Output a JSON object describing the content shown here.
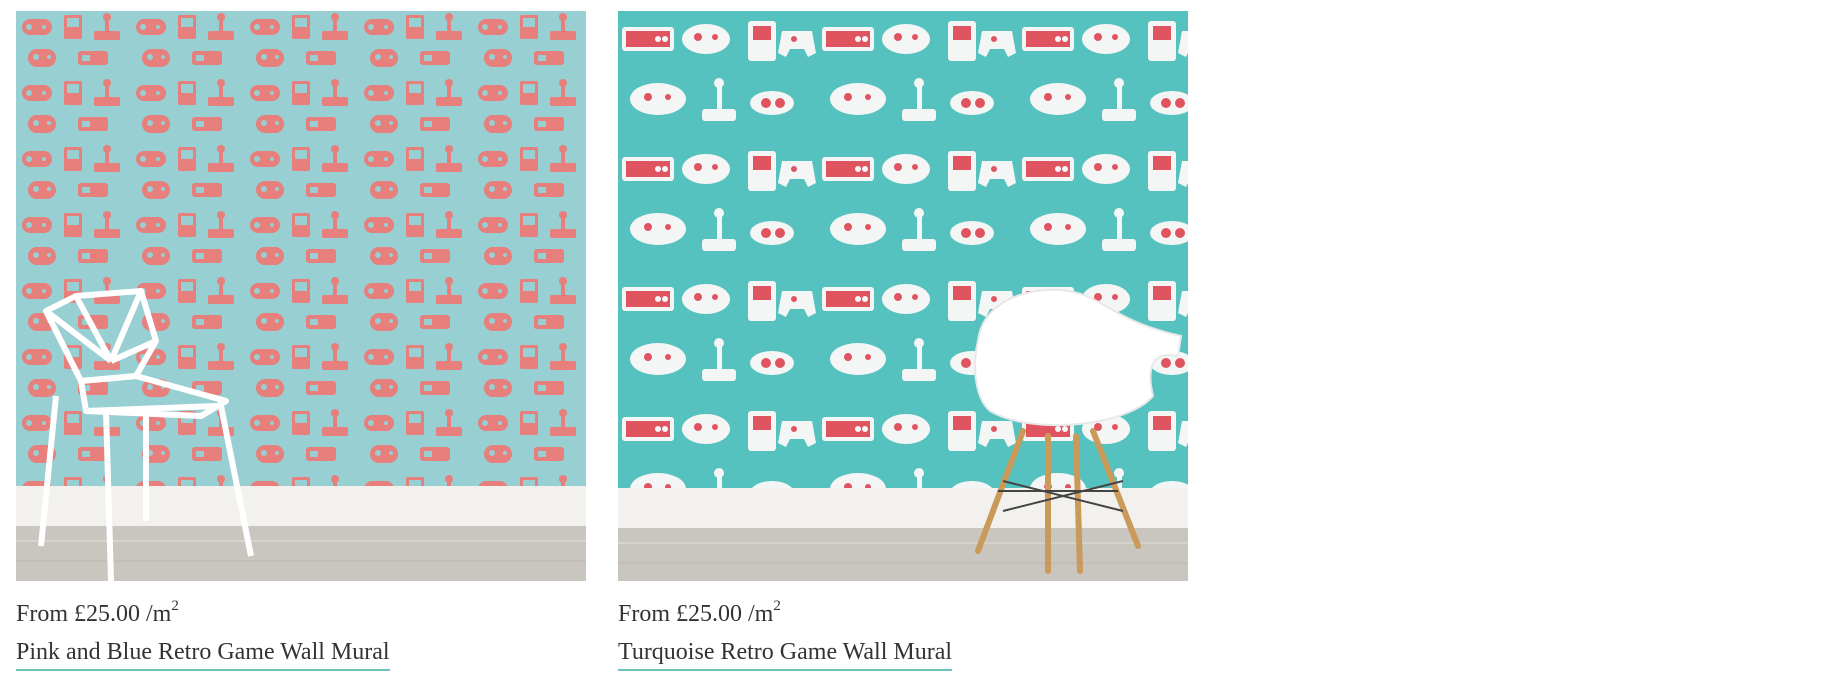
{
  "products": [
    {
      "price_prefix": "From £25.00 /m",
      "price_unit_power": "2",
      "title": "Pink and Blue Retro Game Wall Mural",
      "colors": {
        "wall": "#97cfd2",
        "pattern": "#e77f7c",
        "skirting": "#f2f1ee",
        "floor": "#c9c5bf"
      }
    },
    {
      "price_prefix": "From £25.00 /m",
      "price_unit_power": "2",
      "title": "Turquoise Retro Game Wall Mural",
      "colors": {
        "wall": "#55c2bf",
        "pattern": "#f4f6f6",
        "accent": "#e05460",
        "skirting": "#f2f1ee",
        "floor": "#c9c5bf"
      }
    }
  ]
}
